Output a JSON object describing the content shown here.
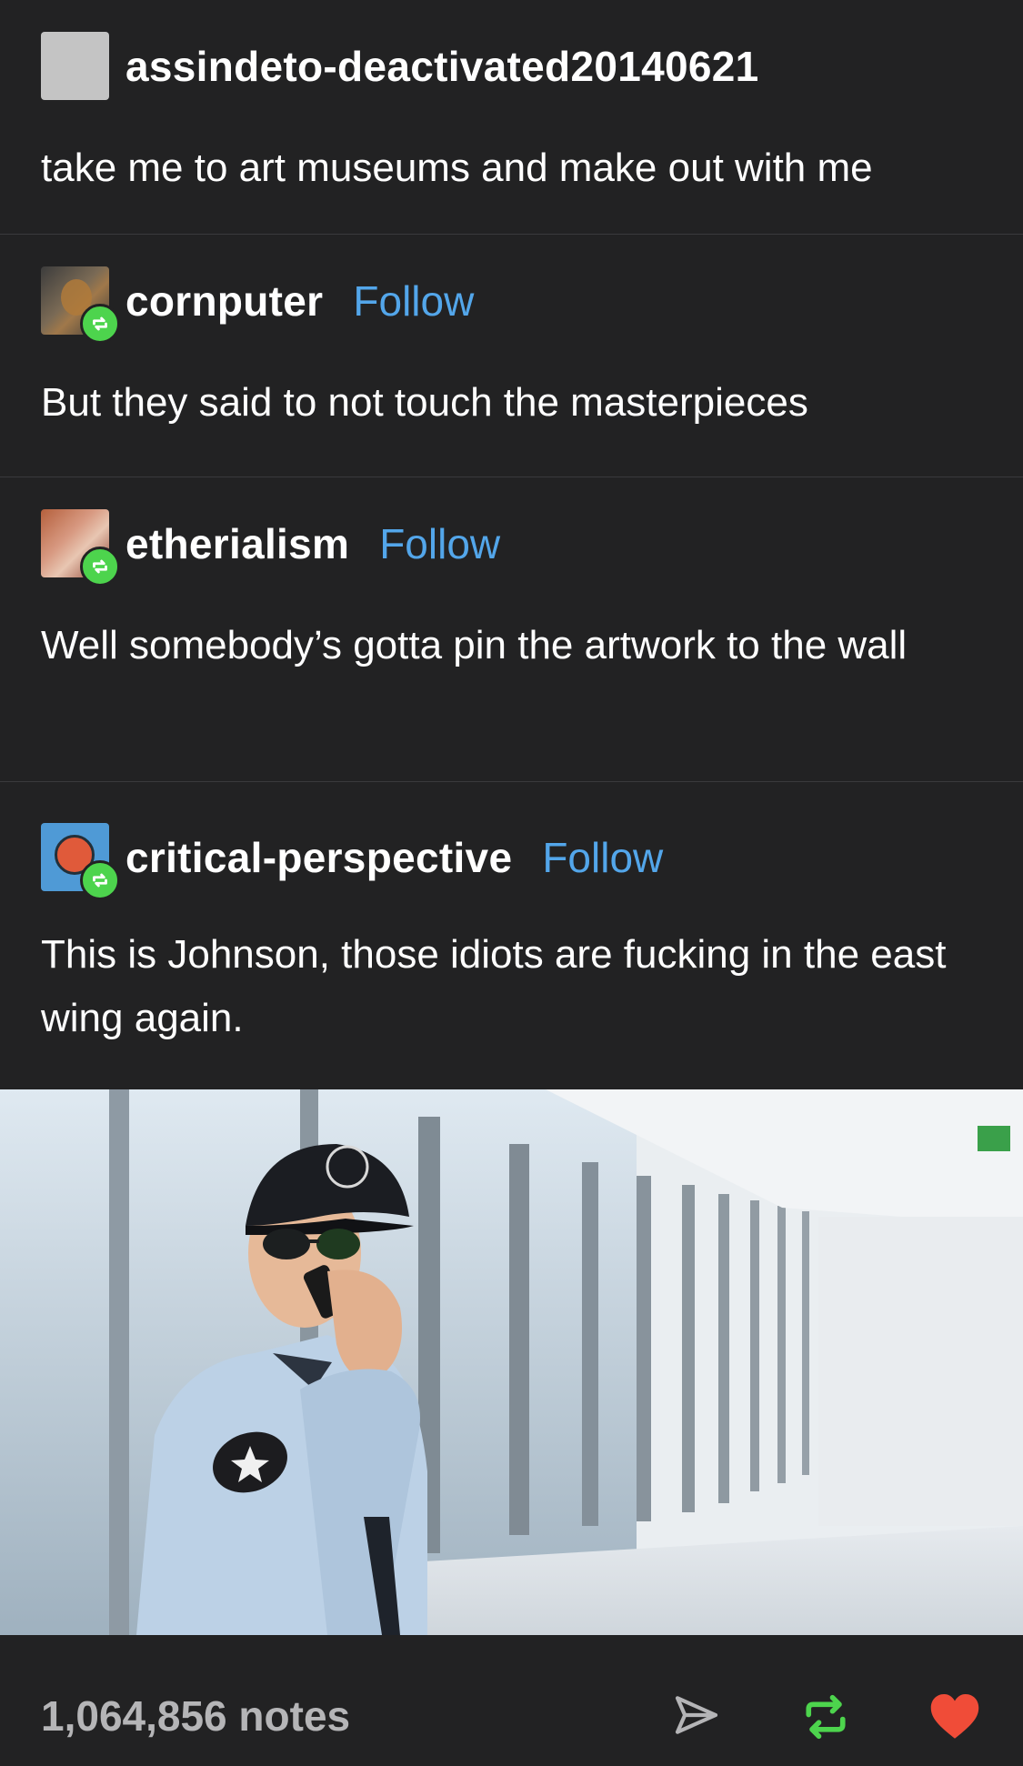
{
  "posts": [
    {
      "username": "assindeto-deactivated20140621",
      "follow_label": "",
      "text": "take me to art museums and make out with me"
    },
    {
      "username": "cornputer",
      "follow_label": "Follow",
      "text": "But they said to not touch the masterpieces"
    },
    {
      "username": "etherialism",
      "follow_label": "Follow",
      "text": "Well somebody’s gotta pin the artwork to the wall"
    },
    {
      "username": "critical-perspective",
      "follow_label": "Follow",
      "text": "This is Johnson, those idiots are fucking in the east wing again."
    }
  ],
  "footer": {
    "notes": "1,064,856 notes"
  },
  "colors": {
    "background": "#222223",
    "follow": "#53a6ea",
    "reblog": "#4dd44d",
    "like": "#f04c38",
    "notes": "#b5b5b7"
  },
  "icons": {
    "share": "paper-plane-icon",
    "reblog": "reblog-icon",
    "like": "heart-icon"
  }
}
